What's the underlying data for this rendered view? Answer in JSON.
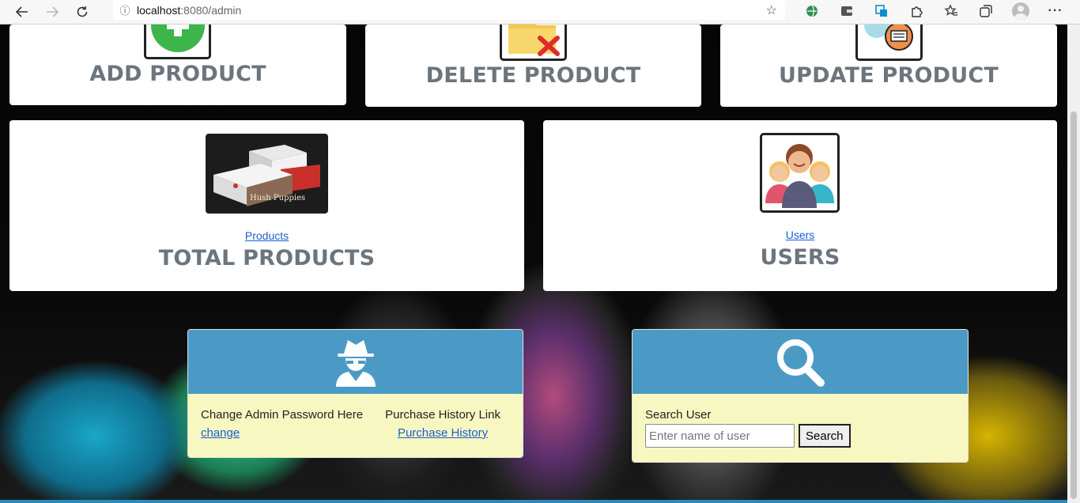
{
  "browser": {
    "url_host": "localhost",
    "url_path": ":8080/admin"
  },
  "cards": {
    "add_title": "ADD PRODUCT",
    "delete_title": "DELETE PRODUCT",
    "update_title": "UPDATE PRODUCT",
    "products_link": "Products",
    "products_title": "TOTAL PRODUCTS",
    "users_link": "Users",
    "users_title": "USERS"
  },
  "admin_panel": {
    "change_label": "Change Admin Password Here",
    "change_link": "change",
    "history_label": "Purchase History Link",
    "history_link": "Purchase History"
  },
  "search_panel": {
    "label": "Search User",
    "placeholder": "Enter name of user",
    "button": "Search"
  },
  "colors": {
    "panel_header": "#4b9ac6",
    "panel_body": "#f7f7c2",
    "card_title": "#6c757d",
    "link": "#1a5fd0"
  }
}
